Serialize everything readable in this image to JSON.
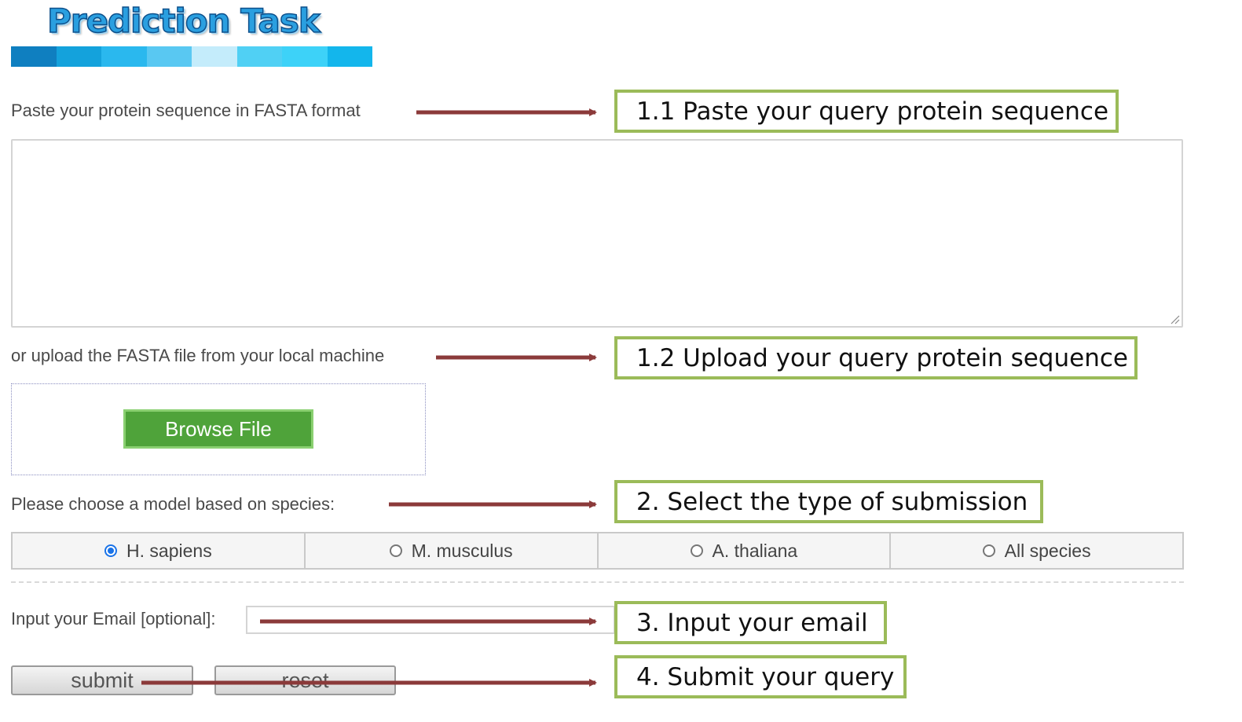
{
  "header": {
    "title": "Prediction Task",
    "bar_colors": [
      "#0f7fc0",
      "#14a2dc",
      "#2ab8ee",
      "#59c8f2",
      "#c4ecfb",
      "#50d0f4",
      "#3dd2f8",
      "#13b6ec"
    ]
  },
  "form": {
    "sequence_label": "Paste your protein sequence in FASTA format",
    "sequence_value": "",
    "upload_label": "or upload the FASTA file from your local machine",
    "browse_label": "Browse File",
    "species_label": "Please choose a model based on species:",
    "species_options": [
      {
        "label": "H. sapiens",
        "selected": true
      },
      {
        "label": "M. musculus",
        "selected": false
      },
      {
        "label": "A. thaliana",
        "selected": false
      },
      {
        "label": "All species",
        "selected": false
      }
    ],
    "email_label": "Input your Email [optional]:",
    "email_value": "",
    "submit_label": "submit",
    "reset_label": "reset"
  },
  "callouts": {
    "step_1_1": "1.1 Paste your query protein sequence",
    "step_1_2": "1.2 Upload your query protein sequence",
    "step_2": "2. Select the type of submission",
    "step_3": "3. Input your email",
    "step_4": "4. Submit your query"
  },
  "colors": {
    "callout_border": "#9bbb59",
    "arrow": "#8b3a3a",
    "browse_button": "#4fa33a",
    "selected_radio": "#1a73e8"
  }
}
